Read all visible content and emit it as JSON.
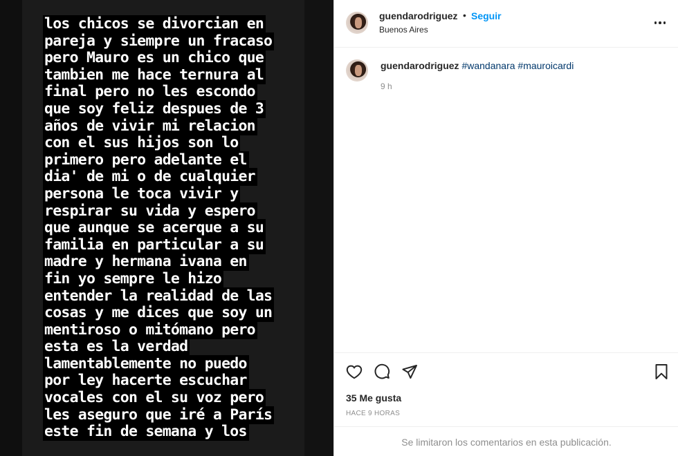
{
  "story": {
    "lines": [
      "los chicos se divorcian en",
      "pareja y siempre un fracaso",
      "pero Mauro es un chico que",
      "tambien me hace ternura al",
      "final pero no les escondo",
      "que soy feliz despues de 3",
      "años de vivir mi relacion",
      "con el sus hijos son lo",
      "primero pero adelante el",
      "dia' de mi o de cualquier",
      "persona le toca vivir y",
      "respirar su vida y espero",
      "que aunque se acerque a su",
      "familia en particular a su",
      "madre y hermana ivana en",
      "fin yo sempre le hizo",
      "entender la realidad de las",
      "cosas y me dices que soy un",
      "mentiroso o mitómano pero",
      "esta es la verdad",
      "lamentablemente no puedo",
      "por ley hacerte escuchar",
      "vocales con el su voz pero",
      "les aseguro que iré a París",
      "este fin de semana y los"
    ]
  },
  "header": {
    "username": "guendarodriguez",
    "separator": "•",
    "follow_label": "Seguir",
    "location": "Buenos Aires",
    "more_icon": "more-options-icon"
  },
  "caption": {
    "username": "guendarodriguez",
    "hashtags": [
      "#wandanara",
      "#mauroicardi"
    ],
    "time": "9 h"
  },
  "actions": {
    "likes": "35 Me gusta",
    "post_time": "HACE 9 HORAS",
    "comments_disabled": "Se limitaron los comentarios en esta publicación.",
    "icons": [
      "heart-icon",
      "comment-icon",
      "share-icon",
      "bookmark-icon"
    ]
  },
  "colors": {
    "link_blue": "#0095f6",
    "hashtag": "#00376b",
    "muted": "#8e8e8e",
    "text": "#262626"
  }
}
